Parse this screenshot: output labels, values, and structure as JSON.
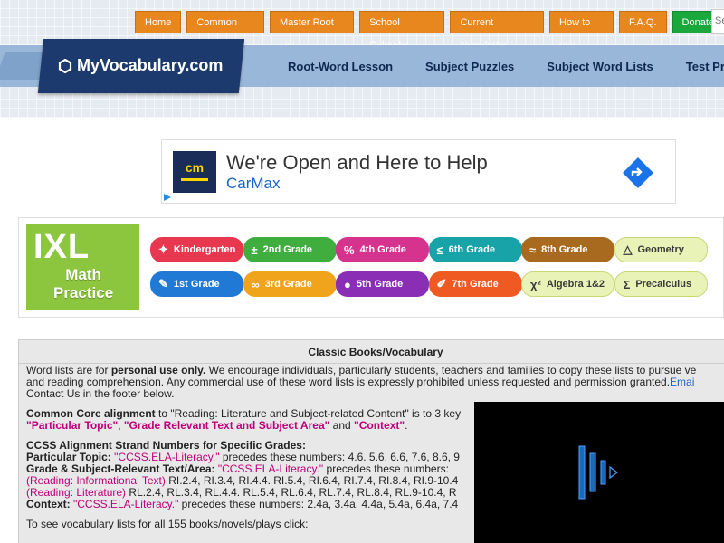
{
  "nav": {
    "top_buttons": [
      "Home",
      "Common Core",
      "Master Root List",
      "School Calendar",
      "Current Newsletter",
      "How to use",
      "F.A.Q.",
      "Donate"
    ],
    "search_placeholder": "Se"
  },
  "logo": {
    "text": "MyVocabulary.com"
  },
  "main_nav": [
    "Root-Word Lesson",
    "Subject Puzzles",
    "Subject Word Lists",
    "Test Pre"
  ],
  "ad": {
    "logo_text": "cm",
    "headline": "We're Open and Here to Help",
    "advertiser": "CarMax"
  },
  "ixl": {
    "logo": "IXL",
    "title_line1": "Math",
    "title_line2": "Practice",
    "grades": [
      {
        "label": "Kindergarten",
        "icon": "✦",
        "color": "#e8384f"
      },
      {
        "label": "2nd Grade",
        "icon": "±",
        "color": "#3fae3f"
      },
      {
        "label": "4th Grade",
        "icon": "%",
        "color": "#d6338f"
      },
      {
        "label": "6th Grade",
        "icon": "≤",
        "color": "#17a3a8"
      },
      {
        "label": "8th Grade",
        "icon": "≈",
        "color": "#a86a1e"
      },
      {
        "label": "Geometry",
        "icon": "△",
        "color": "#e9f3b8"
      },
      {
        "label": "1st Grade",
        "icon": "✎",
        "color": "#2079d4"
      },
      {
        "label": "3rd Grade",
        "icon": "∞",
        "color": "#f0a41c"
      },
      {
        "label": "5th Grade",
        "icon": "●",
        "color": "#8a2fb5"
      },
      {
        "label": "7th Grade",
        "icon": "✐",
        "color": "#ee5a22"
      },
      {
        "label": "Algebra 1&2",
        "icon": "χ²",
        "color": "#e9f3b8"
      },
      {
        "label": "Precalculus",
        "icon": "Σ",
        "color": "#e9f3b8"
      }
    ]
  },
  "content": {
    "heading": "Classic Books/Vocabulary",
    "p1_a": "Word lists are for ",
    "p1_b": "personal use only.",
    "p1_c": " We encourage individuals, particularly students, teachers and families to copy these lists to pursue ve",
    "p1_line2": "and reading comprehension. Any commercial use of these word lists is expressly prohibited unless requested and permission granted.",
    "p1_link": "Emai",
    "p1_line3": "Contact Us in the footer below.",
    "cc_label": "Common Core alignment",
    "cc_text": " to \"Reading: Literature and Subject-related Content\" is to 3 key",
    "cc_q1": "\"Particular Topic\"",
    "cc_q2": "\"Grade Relevant Text and Subject Area\"",
    "cc_and": " and ",
    "cc_q3": "\"Context\"",
    "cc_dot": ".",
    "strand_head": "CCSS Alignment Strand Numbers for Specific Grades:",
    "pt_label": "Particular Topic: ",
    "pt_code": "\"CCSS.ELA-Literacy.\"",
    "pt_text": " precedes these numbers: 4.6. 5.6, 6.6, 7.6, 8.6, 9",
    "gr_label": "Grade & Subject-Relevant Text/Area: ",
    "gr_code": "\"CCSS.ELA-Literacy.\"",
    "gr_text": " precedes these numbers:",
    "ri_label": "(Reading: Informational Text)",
    "ri_text": " RI.2.4, RI.3.4, RI.4.4. RI.5.4, RI.6.4, RI.7.4, RI.8.4, RI.9-10.4",
    "rl_label": "(Reading: Literature)",
    "rl_text": " RL.2.4, RL.3.4, RL.4.4. RL.5.4, RL.6.4, RL.7.4, RL.8.4, RL.9-10.4, R",
    "cx_label": "Context: ",
    "cx_code": "\"CCSS.ELA-Literacy.\"",
    "cx_text": " precedes these numbers: 2.4a, 3.4a, 4.4a, 5.4a, 6.4a, 7.4",
    "bottom": "To see vocabulary lists for all 155 books/novels/plays click:"
  }
}
